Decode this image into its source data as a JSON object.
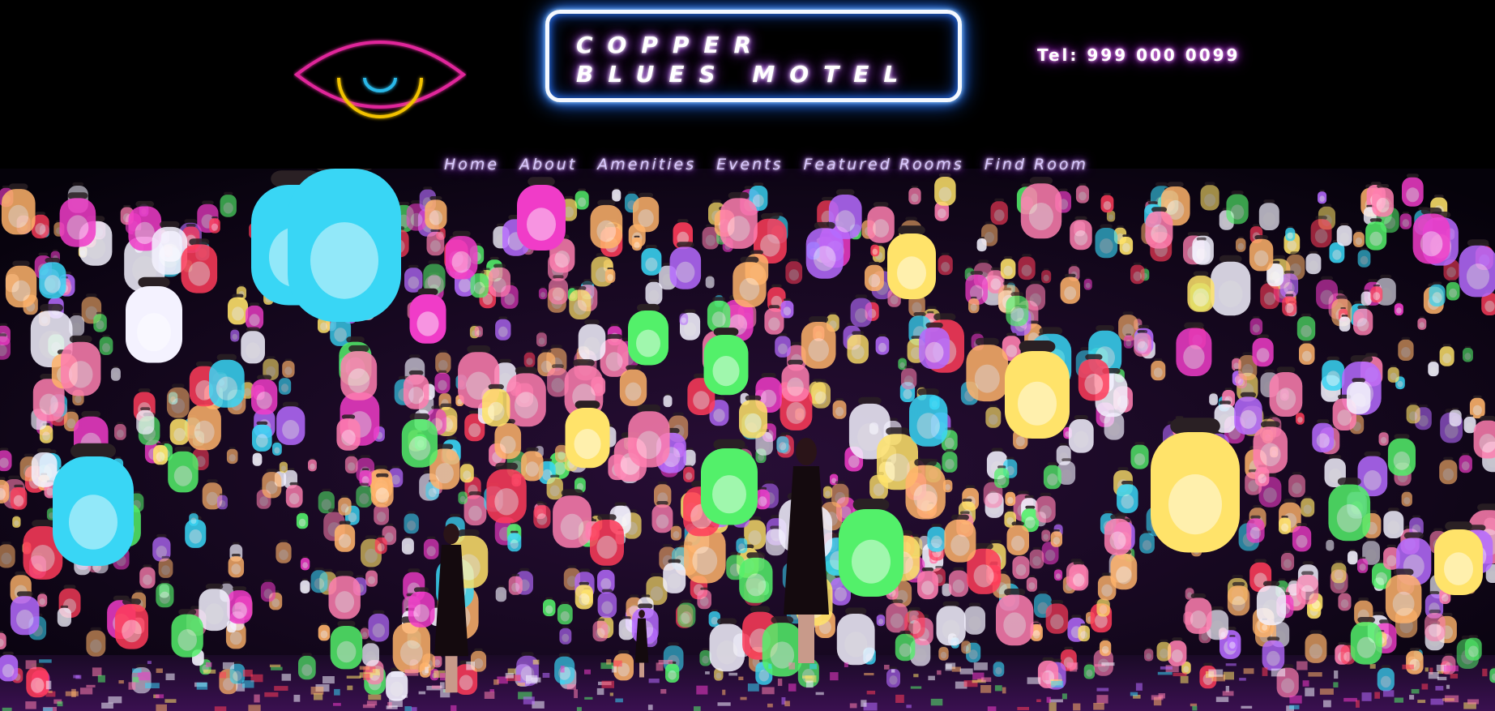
{
  "brand": {
    "line1": "COPPER",
    "line2": "BLUES MOTEL"
  },
  "logo": {
    "icon": "eye-icon",
    "colors": {
      "outline": "#e0269a",
      "iris": "#f2c200",
      "pupil": "#2ab8e8"
    }
  },
  "contact": {
    "phone": "Tel: 999 000 0099"
  },
  "nav": {
    "items": [
      {
        "label": "Home"
      },
      {
        "label": "About"
      },
      {
        "label": "Amenities"
      },
      {
        "label": "Events"
      },
      {
        "label": "Featured Rooms"
      },
      {
        "label": "Find Room"
      }
    ]
  },
  "hero": {
    "image": "hero-lantern-forest-image",
    "colors": {
      "cyan": "#39d6f5",
      "magenta": "#f03cc8",
      "pink": "#ff7fb0",
      "orange": "#ffb36b",
      "yellow": "#ffe36a",
      "green": "#53f06a",
      "white": "#f4f2ff",
      "red": "#ff3c5a",
      "purple": "#b66bff"
    }
  },
  "colors": {
    "background": "#000000",
    "brand_border": "#f4f8ff",
    "brand_glow": "#2d7cff",
    "text_glow": "#a23bff"
  }
}
